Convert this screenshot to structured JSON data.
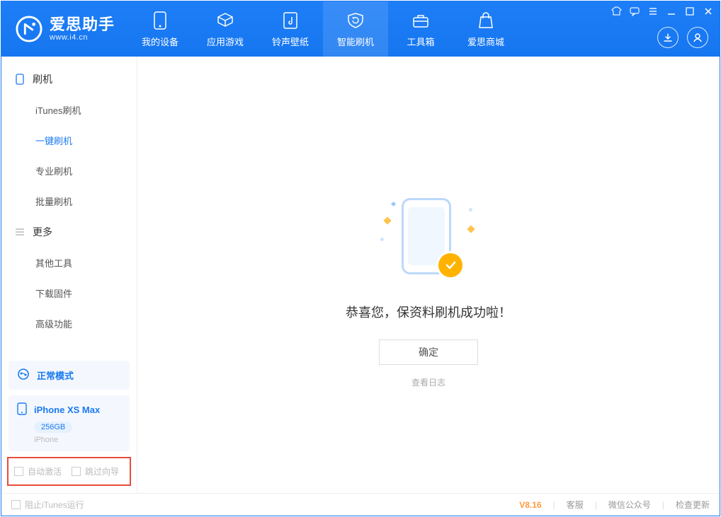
{
  "app": {
    "name": "爱思助手",
    "url": "www.i4.cn"
  },
  "nav": {
    "items": [
      {
        "label": "我的设备"
      },
      {
        "label": "应用游戏"
      },
      {
        "label": "铃声壁纸"
      },
      {
        "label": "智能刷机"
      },
      {
        "label": "工具箱"
      },
      {
        "label": "爱思商城"
      }
    ]
  },
  "sidebar": {
    "group1": "刷机",
    "items1": [
      "iTunes刷机",
      "一键刷机",
      "专业刷机",
      "批量刷机"
    ],
    "group2": "更多",
    "items2": [
      "其他工具",
      "下载固件",
      "高级功能"
    ],
    "mode": "正常模式",
    "device": {
      "name": "iPhone XS Max",
      "capacity": "256GB",
      "sub": "iPhone"
    },
    "auto_activate": "自动激活",
    "skip_guide": "跳过向导"
  },
  "main": {
    "message": "恭喜您，保资料刷机成功啦！",
    "ok": "确定",
    "view_log": "查看日志"
  },
  "status": {
    "block_itunes": "阻止iTunes运行",
    "version": "V8.16",
    "support": "客服",
    "wechat": "微信公众号",
    "check_update": "检查更新"
  }
}
